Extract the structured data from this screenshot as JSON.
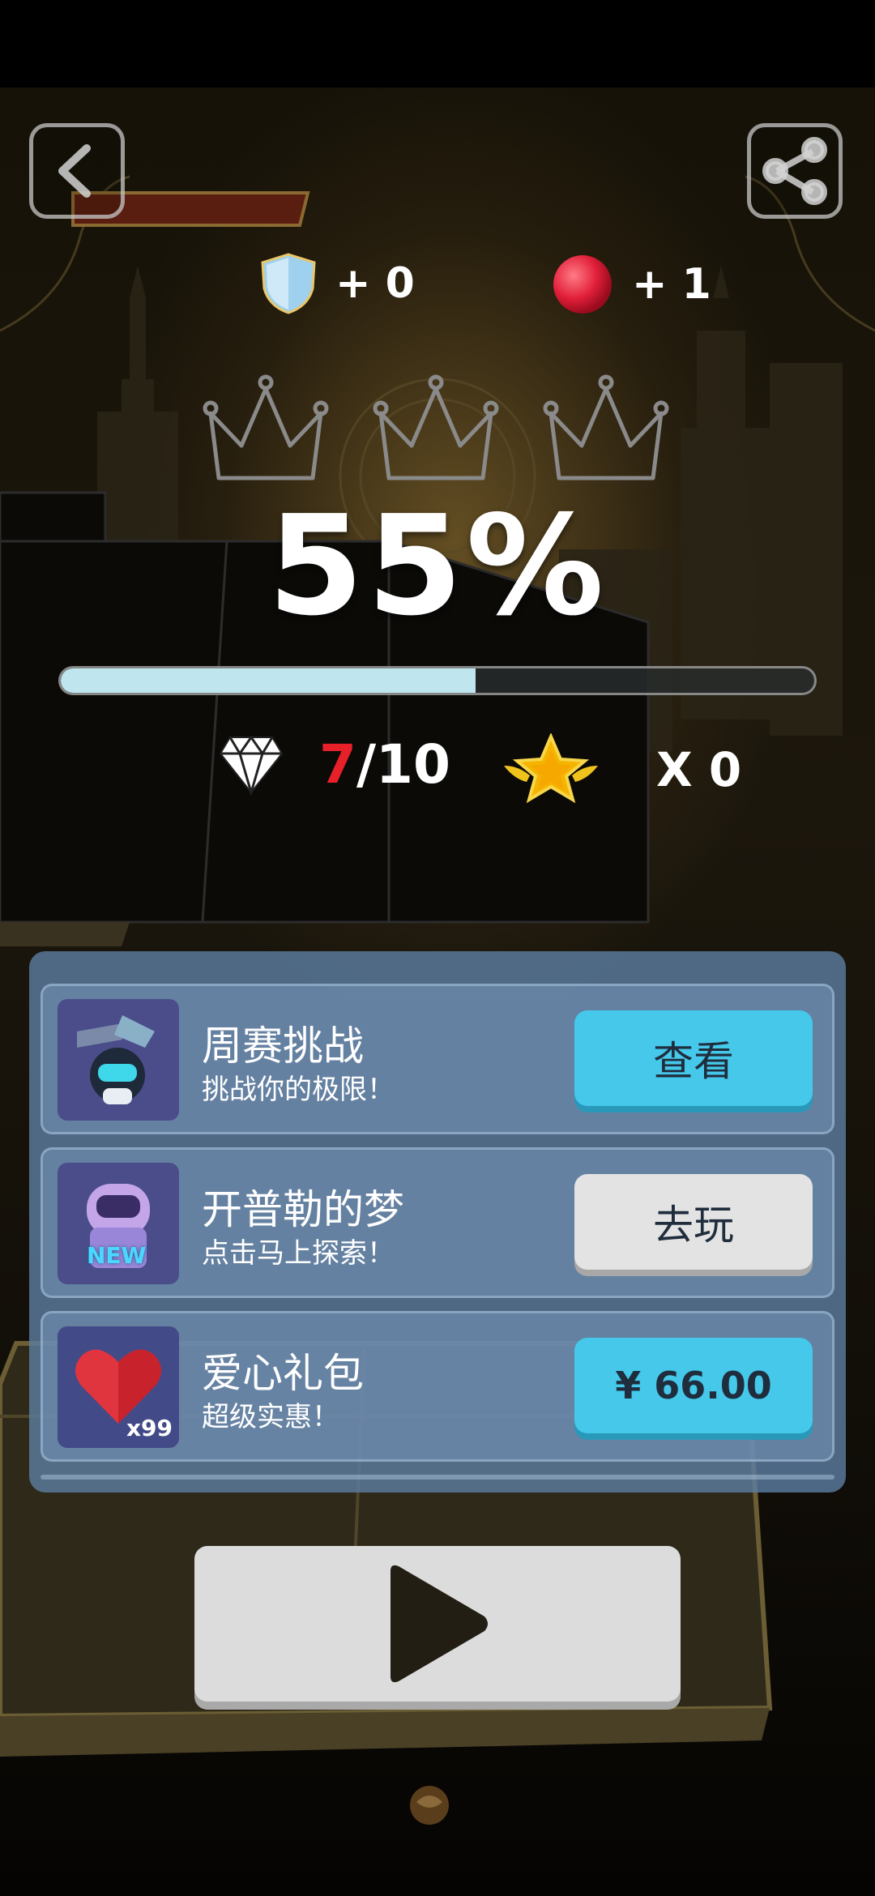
{
  "rewards": {
    "shield_count": "+ 0",
    "ball_count": "+ 1"
  },
  "progress": {
    "percent_label": "55%",
    "fraction": 0.55
  },
  "stats": {
    "gems_collected": "7",
    "gems_total": "/10",
    "stars_label": "X 0"
  },
  "offers": [
    {
      "title": "周赛挑战",
      "subtitle": "挑战你的极限！",
      "button": "查看"
    },
    {
      "title": "开普勒的梦",
      "subtitle": "点击马上探索！",
      "button": "去玩",
      "badge": "NEW"
    },
    {
      "title": "爱心礼包",
      "subtitle": "超级实惠！",
      "button": "¥ 66.00",
      "quantity": "x99"
    }
  ],
  "icons": [
    "back-icon",
    "share-icon",
    "shield-icon",
    "ball-icon",
    "crown-icon",
    "diamond-icon",
    "star-icon",
    "play-icon"
  ],
  "colors": {
    "accent_blue": "#45c8ea",
    "progress_fill": "#bfe5ef",
    "gem_red": "#e8202a",
    "panel": "#5c7da0"
  }
}
